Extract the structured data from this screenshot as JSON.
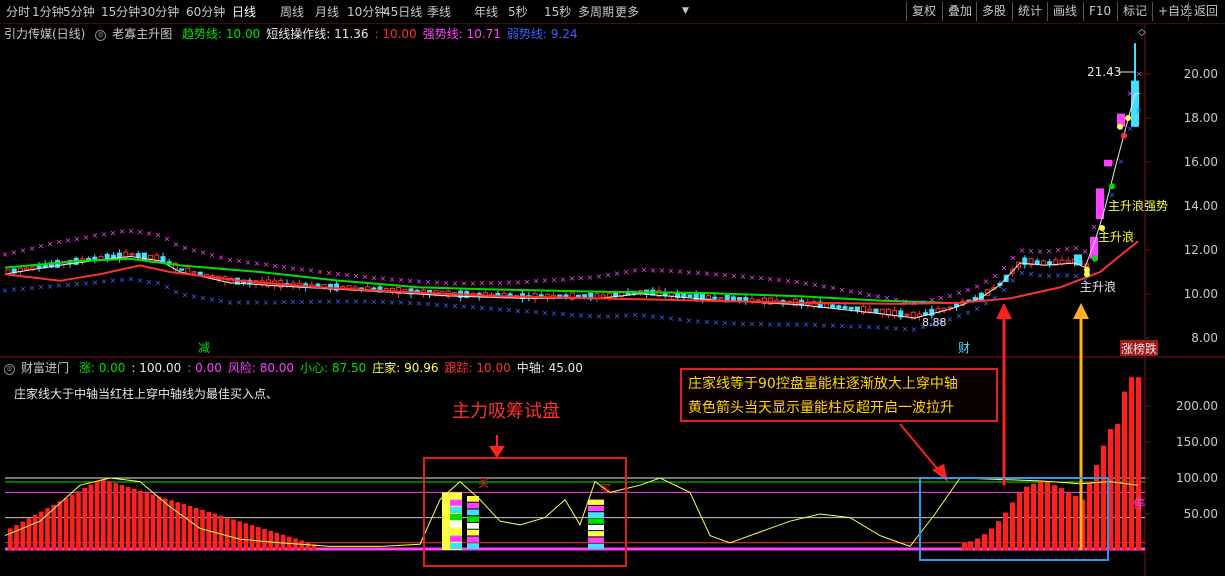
{
  "toolbar": {
    "periods": [
      "分时",
      "1分钟",
      "5分钟",
      "15分钟",
      "30分钟",
      "60分钟",
      "日线",
      "周线",
      "月线",
      "10分钟",
      "45日线",
      "季线",
      "年线",
      "5秒",
      "15秒",
      "多周期",
      "更多"
    ],
    "active": "日线",
    "right_buttons": [
      "复权",
      "叠加",
      "多股",
      "统计",
      "画线",
      "F10",
      "标记",
      "+自选",
      "返回"
    ]
  },
  "main_legend": {
    "title": "引力传媒(日线)",
    "indicator": "老寡主升图",
    "items": [
      {
        "label": "趋势线: 10.00",
        "color": "#00e000"
      },
      {
        "label": "短线操作线: 11.36",
        "color": "#e8e8e8"
      },
      {
        "label": ": 10.00",
        "color": "#ff3030"
      },
      {
        "label": "强势线: 10.71",
        "color": "#ff40ff"
      },
      {
        "label": "弱势线: 9.24",
        "color": "#4060ff"
      }
    ]
  },
  "main_axis": {
    "ticks": [
      "20.00",
      "18.00",
      "16.00",
      "14.00",
      "12.00",
      "10.00",
      "8.00"
    ],
    "values": [
      20,
      18,
      16,
      14,
      12,
      10,
      8
    ]
  },
  "main_labels": {
    "high": "21.43",
    "low": "8.88",
    "tag_jian": "减",
    "tag_cai": "财",
    "tag_ztd": "涨榜跌",
    "wave1": "主升浪",
    "wave2": "主升浪",
    "wave3": "主升浪强势"
  },
  "sub_legend": {
    "indicator": "财富进门",
    "items": [
      {
        "label": "涨: 0.00",
        "color": "#00e000"
      },
      {
        "label": ": 100.00",
        "color": "#e8e8e8"
      },
      {
        "label": ": 0.00",
        "color": "#ff40ff"
      },
      {
        "label": "风险: 80.00",
        "color": "#ff40ff"
      },
      {
        "label": "小心: 87.50",
        "color": "#00e000"
      },
      {
        "label": "庄家: 90.96",
        "color": "#ffff40"
      },
      {
        "label": "跟踪: 10.00",
        "color": "#ff3030"
      },
      {
        "label": "中轴: 45.00",
        "color": "#e8e8e8"
      }
    ]
  },
  "sub_axis": {
    "ticks": [
      "200.00",
      "150.00",
      "100.00",
      "50.00"
    ],
    "values": [
      200,
      150,
      100,
      50
    ]
  },
  "sub_labels": {
    "note": "庄家线大于中轴当红柱上穿中轴线为最佳买入点、",
    "mark_buy": "买",
    "mark_stop": "停"
  },
  "annotations": {
    "title_red": "主力吸筹试盘",
    "box_line1": "庄家线等于90控盘量能柱逐渐放大上穿中轴",
    "box_line2": "黄色箭头当天显示量能柱反超开启一波拉升"
  },
  "colors": {
    "up": "#ff3030",
    "down": "#40e0ff",
    "trend": "#00e000",
    "strong": "#ff40ff",
    "weak": "#4060ff",
    "zhuang": "#ffff40"
  }
}
